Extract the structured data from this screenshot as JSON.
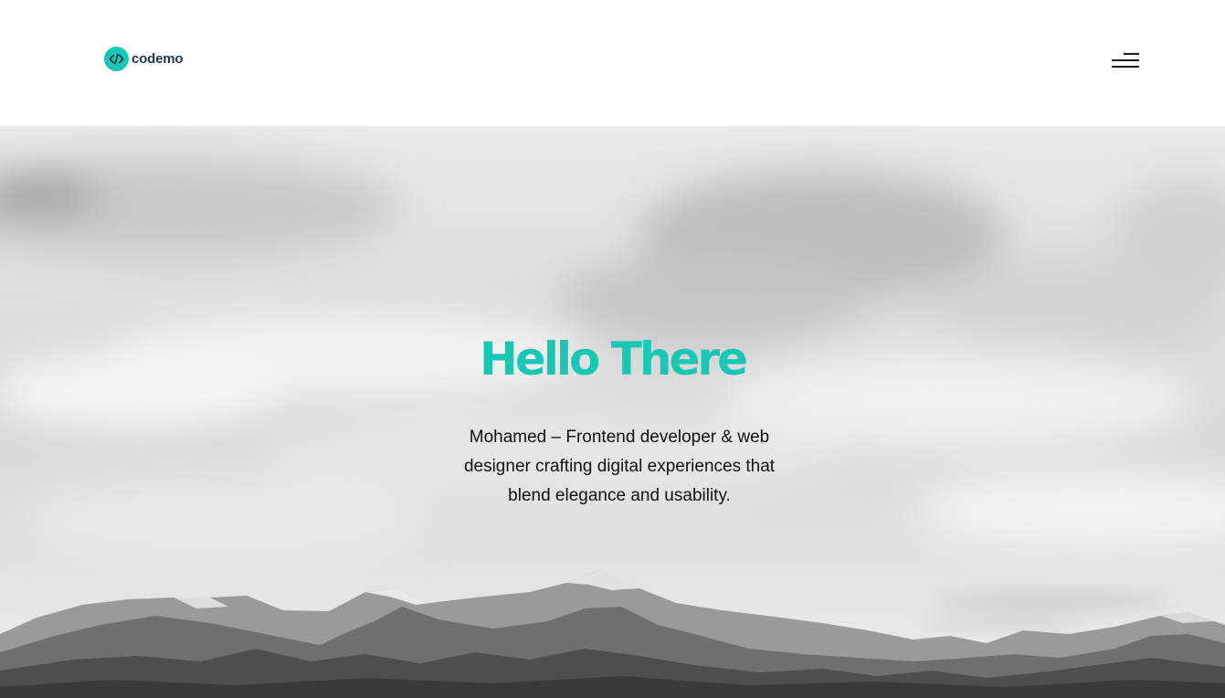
{
  "header": {
    "logo": {
      "text": "codemo",
      "icon": "code-brackets-icon"
    },
    "menu": {
      "icon": "hamburger-menu-icon"
    }
  },
  "hero": {
    "title": "Hello There",
    "description": "Mohamed – Frontend developer & web designer crafting digital experiences that blend elegance and usability.",
    "background": "grayscale-mountain-landscape"
  },
  "colors": {
    "accent": "#1ac7b4",
    "logo_text": "#1f3a4a",
    "text": "#111111",
    "header_bg": "#ffffff"
  }
}
